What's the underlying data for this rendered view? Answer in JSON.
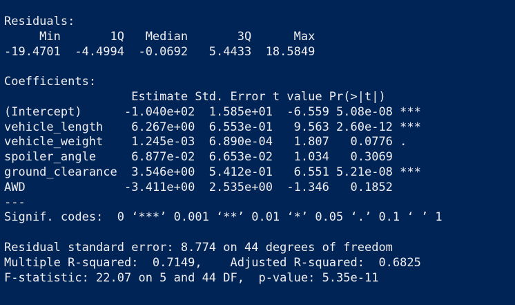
{
  "theme": {
    "background": "#012456",
    "foreground": "#EEEDF0"
  },
  "console": {
    "lines": [
      "Residuals:",
      "     Min       1Q   Median       3Q      Max ",
      "-19.4701  -4.4994  -0.0692   5.4433  18.5849 ",
      "",
      "Coefficients:",
      "                  Estimate Std. Error t value Pr(>|t|)    ",
      "(Intercept)      -1.040e+02  1.585e+01  -6.559 5.08e-08 ***",
      "vehicle_length    6.267e+00  6.553e-01   9.563 2.60e-12 ***",
      "vehicle_weight    1.245e-03  6.890e-04   1.807   0.0776 .  ",
      "spoiler_angle     6.877e-02  6.653e-02   1.034   0.3069    ",
      "ground_clearance  3.546e+00  5.412e-01   6.551 5.21e-08 ***",
      "AWD              -3.411e+00  2.535e+00  -1.346   0.1852    ",
      "---",
      "Signif. codes:  0 ‘***’ 0.001 ‘**’ 0.01 ‘*’ 0.05 ‘.’ 0.1 ‘ ’ 1",
      "",
      "Residual standard error: 8.774 on 44 degrees of freedom",
      "Multiple R-squared:  0.7149,\tAdjusted R-squared:  0.6825 ",
      "F-statistic: 22.07 on 5 and 44 DF,  p-value: 5.35e-11"
    ]
  }
}
